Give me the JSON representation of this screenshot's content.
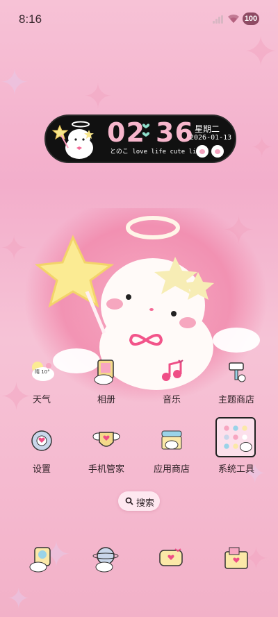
{
  "status_bar": {
    "time": "8:16",
    "battery": "100"
  },
  "clock_widget": {
    "hours": "02",
    "minutes": "36",
    "weekday": "星期二",
    "date": "2026-01-13",
    "tagline": "とのこ love life cute life"
  },
  "apps": [
    {
      "label": "天气",
      "icon": "weather-icon",
      "badge": "晴 10°"
    },
    {
      "label": "相册",
      "icon": "gallery-icon"
    },
    {
      "label": "音乐",
      "icon": "music-icon"
    },
    {
      "label": "主题商店",
      "icon": "theme-store-icon"
    },
    {
      "label": "设置",
      "icon": "settings-icon"
    },
    {
      "label": "手机管家",
      "icon": "phone-manager-icon"
    },
    {
      "label": "应用商店",
      "icon": "app-store-icon"
    },
    {
      "label": "系统工具",
      "icon": "system-tools-folder-icon"
    }
  ],
  "search": {
    "label": "搜索"
  },
  "dock": [
    {
      "icon": "phone-icon"
    },
    {
      "icon": "browser-icon"
    },
    {
      "icon": "messages-icon"
    },
    {
      "icon": "files-icon"
    }
  ],
  "colors": {
    "background": "#f5b9cf",
    "widget": "#111111",
    "clock_digits": "#f7b6cc",
    "accent": "#8fe0cc"
  }
}
